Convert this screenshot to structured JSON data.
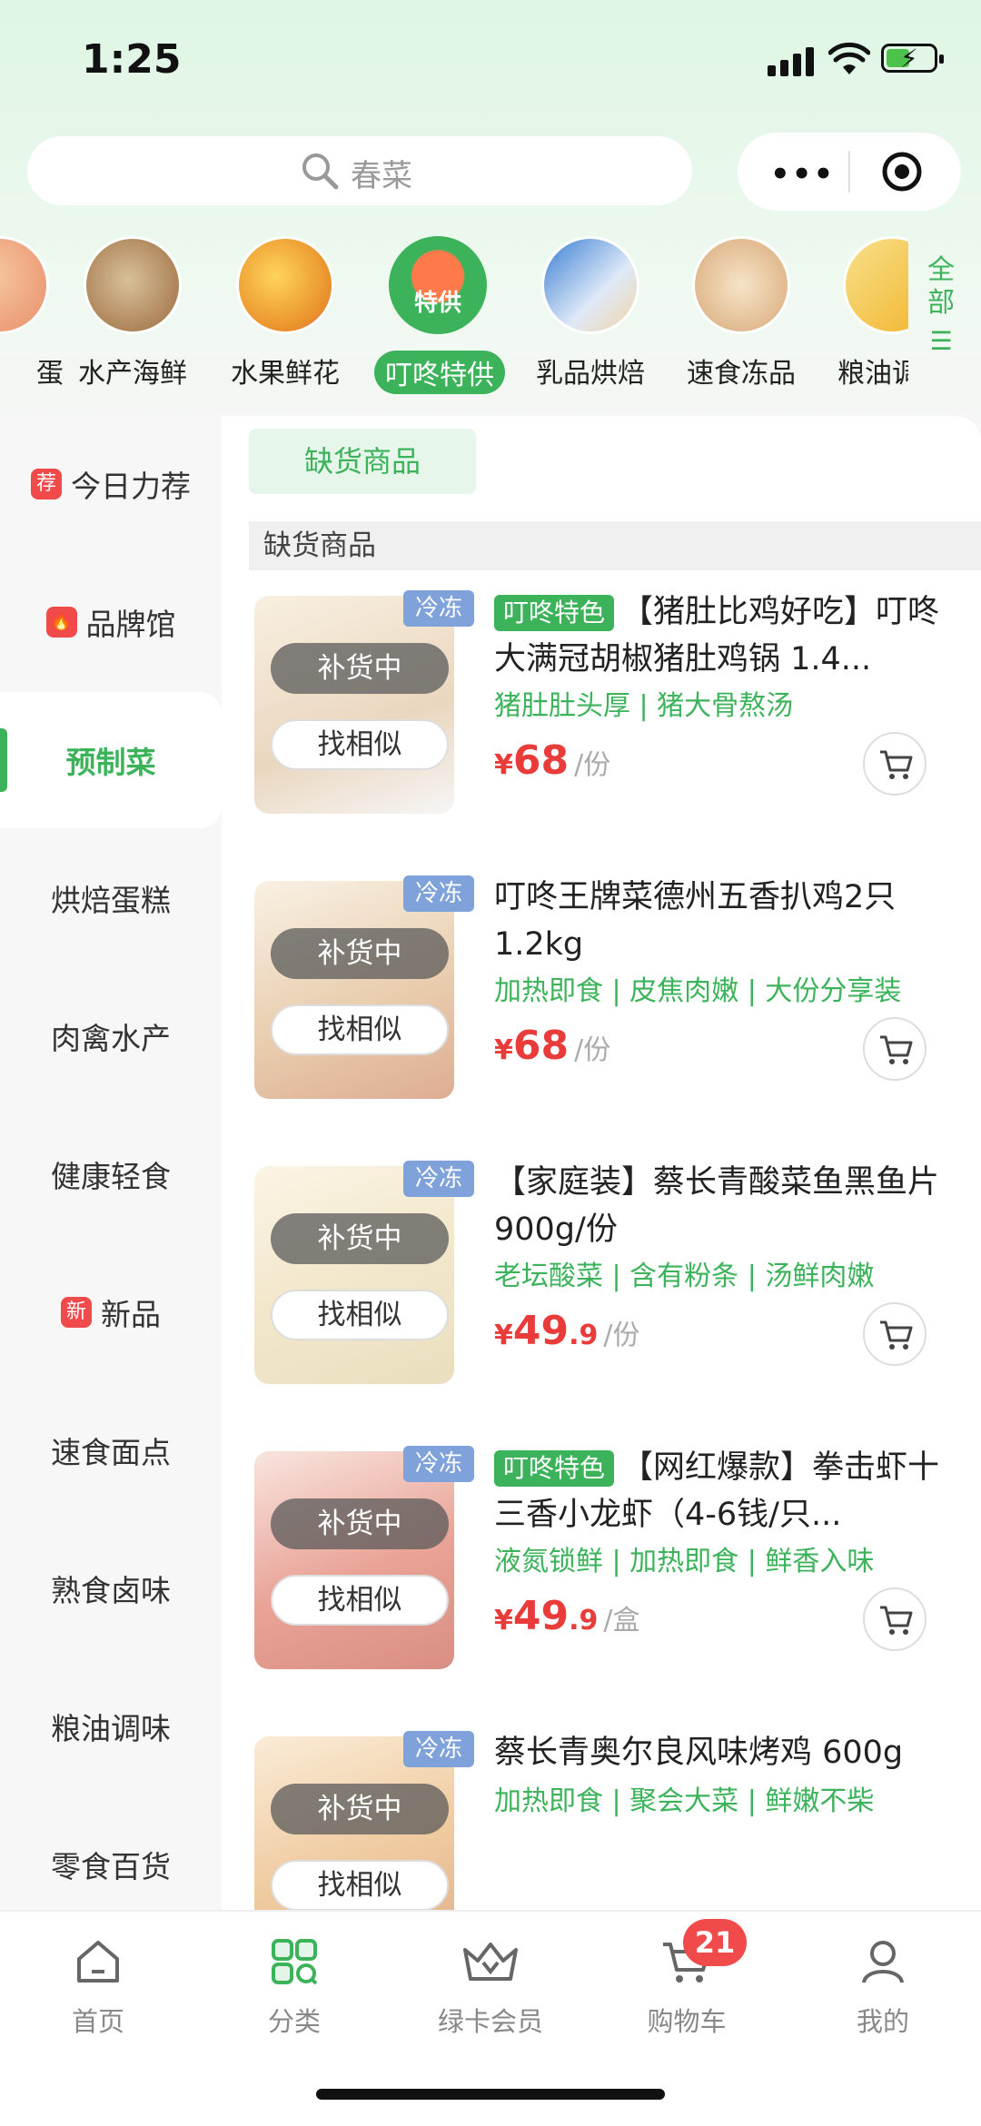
{
  "status": {
    "time": "1:25"
  },
  "search": {
    "placeholder": "春菜"
  },
  "categories": [
    {
      "label": "蛋",
      "color": "#f3b090"
    },
    {
      "label": "水产海鲜",
      "color": "#c9a472"
    },
    {
      "label": "水果鲜花",
      "color": "#f2b52a"
    },
    {
      "label": "叮咚特供",
      "color": "#3cb35a",
      "badge": "特供"
    },
    {
      "label": "乳品烘焙",
      "color": "#3a7fd4"
    },
    {
      "label": "速食冻品",
      "color": "#e6c39a"
    },
    {
      "label": "粮油调",
      "color": "#f3c94a"
    }
  ],
  "all_button": {
    "line1": "全",
    "line2": "部"
  },
  "sidebar": {
    "items": [
      {
        "label": "今日力荐",
        "tag": "荐"
      },
      {
        "label": "品牌馆",
        "tag": "🔥"
      },
      {
        "label": "预制菜",
        "active": true
      },
      {
        "label": "烘焙蛋糕"
      },
      {
        "label": "肉禽水产"
      },
      {
        "label": "健康轻食"
      },
      {
        "label": "新品",
        "tag": "新"
      },
      {
        "label": "速食面点"
      },
      {
        "label": "熟食卤味"
      },
      {
        "label": "粮油调味"
      },
      {
        "label": "零食百货"
      }
    ]
  },
  "filter_chip": "缺货商品",
  "section_header": "缺货商品",
  "products": [
    {
      "cold": "冷冻",
      "special": "叮咚特色",
      "title": "【猪肚比鸡好吃】叮咚大满冠胡椒猪肚鸡锅 1.4...",
      "desc": "猪肚肚头厚 | 猪大骨熬汤",
      "yuan": "¥",
      "price_int": "68",
      "price_dec": "",
      "unit": "/份",
      "restock": "补货中",
      "similar": "找相似",
      "img_color": "#d9b68a"
    },
    {
      "cold": "冷冻",
      "special": "",
      "title": "叮咚王牌菜德州五香扒鸡2只 1.2kg",
      "desc": "加热即食 | 皮焦肉嫩 | 大份分享装",
      "yuan": "¥",
      "price_int": "68",
      "price_dec": "",
      "unit": "/份",
      "restock": "补货中",
      "similar": "找相似",
      "img_color": "#d7a66e"
    },
    {
      "cold": "冷冻",
      "special": "",
      "title": "【家庭装】蔡长青酸菜鱼黑鱼片 900g/份",
      "desc": "老坛酸菜 | 含有粉条 | 汤鲜肉嫩",
      "yuan": "¥",
      "price_int": "49",
      "price_dec": ".9",
      "unit": "/份",
      "restock": "补货中",
      "similar": "找相似",
      "img_color": "#e8d29c"
    },
    {
      "cold": "冷冻",
      "special": "叮咚特色",
      "title": "【网红爆款】拳击虾十三香小龙虾（4-6钱/只...",
      "desc": "液氮锁鲜 | 加热即食 | 鲜香入味",
      "yuan": "¥",
      "price_int": "49",
      "price_dec": ".9",
      "unit": "/盒",
      "restock": "补货中",
      "similar": "找相似",
      "img_color": "#d8563f"
    },
    {
      "cold": "冷冻",
      "special": "",
      "title": "蔡长青奥尔良风味烤鸡 600g",
      "desc": "加热即食 | 聚会大菜 | 鲜嫩不柴",
      "yuan": "¥",
      "price_int": "",
      "price_dec": "",
      "unit": "",
      "restock": "补货中",
      "similar": "找相似",
      "img_color": "#e2a052"
    }
  ],
  "tabbar": {
    "items": [
      {
        "label": "首页"
      },
      {
        "label": "分类"
      },
      {
        "label": "绿卡会员"
      },
      {
        "label": "购物车"
      },
      {
        "label": "我的"
      }
    ],
    "cart_count": "21"
  },
  "accent": "#3cb35a",
  "price_color": "#ea3b3b"
}
